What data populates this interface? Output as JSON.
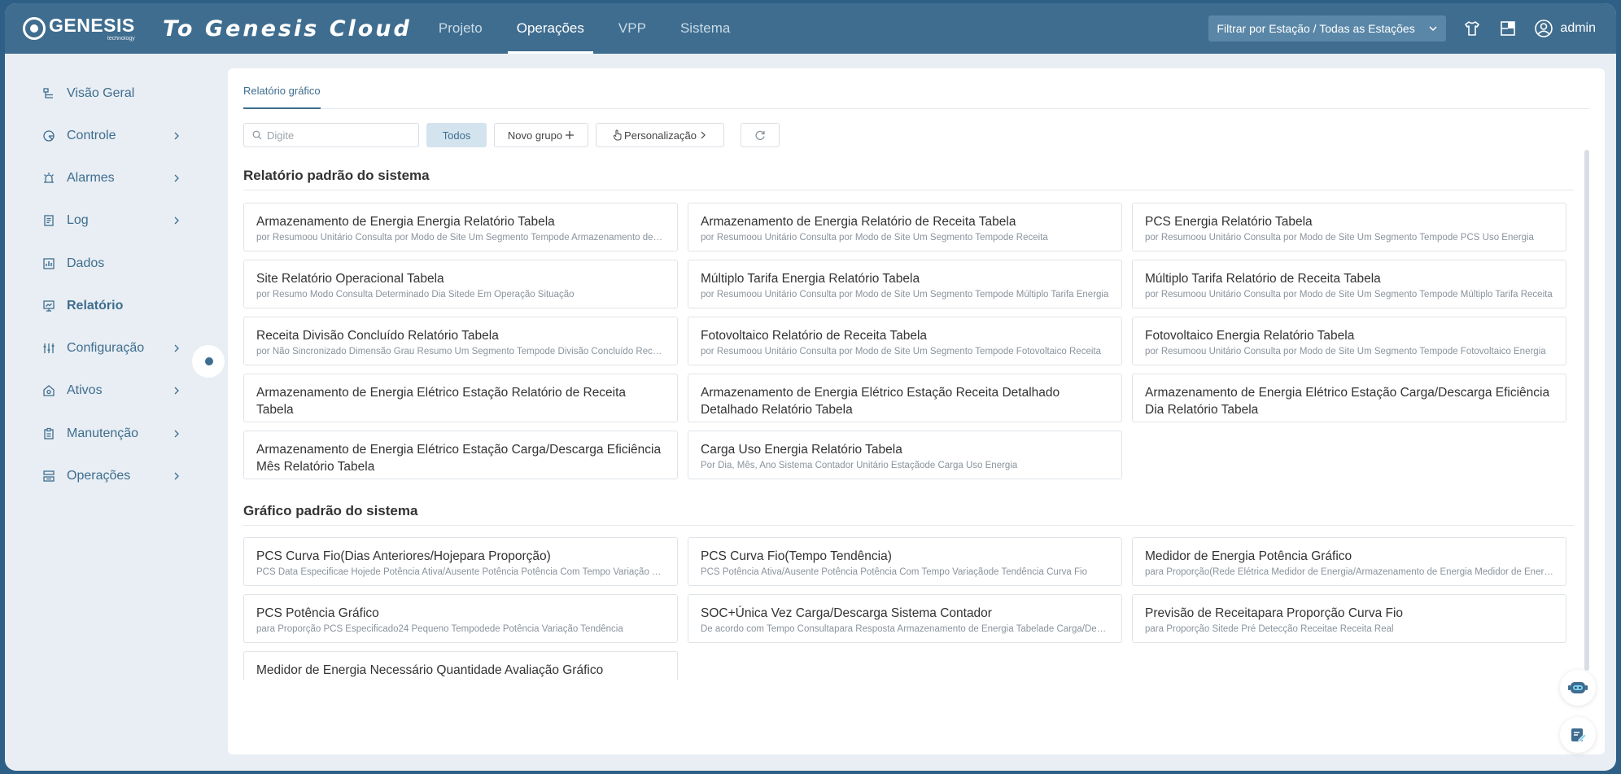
{
  "header": {
    "logo_text": "GENESIS",
    "logo_sub": "technology",
    "brand_title": "To Genesis Cloud",
    "nav": [
      {
        "label": "Projeto",
        "active": false
      },
      {
        "label": "Operações",
        "active": true
      },
      {
        "label": "VPP",
        "active": false
      },
      {
        "label": "Sistema",
        "active": false
      }
    ],
    "station_filter": "Filtrar por Estação / Todas as Estações",
    "user": "admin"
  },
  "sidebar": {
    "items": [
      {
        "label": "Visão Geral",
        "icon": "overview-icon",
        "chevron": false
      },
      {
        "label": "Controle",
        "icon": "control-icon",
        "chevron": true
      },
      {
        "label": "Alarmes",
        "icon": "alarm-icon",
        "chevron": true
      },
      {
        "label": "Log",
        "icon": "log-icon",
        "chevron": true
      },
      {
        "label": "Dados",
        "icon": "data-icon",
        "chevron": false
      },
      {
        "label": "Relatório",
        "icon": "report-icon",
        "chevron": false,
        "active": true
      },
      {
        "label": "Configuração",
        "icon": "config-icon",
        "chevron": true
      },
      {
        "label": "Ativos",
        "icon": "assets-icon",
        "chevron": true
      },
      {
        "label": "Manutenção",
        "icon": "maintenance-icon",
        "chevron": true
      },
      {
        "label": "Operações",
        "icon": "operations-icon",
        "chevron": true
      }
    ]
  },
  "main": {
    "tab": "Relatório gráfico",
    "search_placeholder": "Digite",
    "btn_all": "Todos",
    "btn_new_group": "Novo grupo",
    "btn_custom": "Personalização",
    "sections": [
      {
        "title": "Relatório padrão do sistema",
        "cards": [
          {
            "title": "Armazenamento de Energia Energia Relatório Tabela",
            "desc": "por Resumoou Unitário Consulta por Modo de Site Um Segmento Tempode Armazenamento de Energia Energia"
          },
          {
            "title": "Armazenamento de Energia Relatório de Receita Tabela",
            "desc": "por Resumoou Unitário Consulta por Modo de Site Um Segmento Tempode Receita"
          },
          {
            "title": "PCS Energia Relatório Tabela",
            "desc": "por Resumoou Unitário Consulta por Modo de Site Um Segmento Tempode PCS Uso Energia"
          },
          {
            "title": "Site Relatório Operacional Tabela",
            "desc": "por Resumo Modo Consulta Determinado Dia Sitede Em Operação Situação"
          },
          {
            "title": "Múltiplo Tarifa Energia Relatório Tabela",
            "desc": "por Resumoou Unitário Consulta por Modo de Site Um Segmento Tempode Múltiplo Tarifa Energia"
          },
          {
            "title": "Múltiplo Tarifa Relatório de Receita Tabela",
            "desc": "por Resumoou Unitário Consulta por Modo de Site Um Segmento Tempode Múltiplo Tarifa Receita"
          },
          {
            "title": "Receita Divisão Concluído Relatório Tabela",
            "desc": "por Não Sincronizado Dimensão Grau Resumo Um Segmento Tempode Divisão Concluído Receita"
          },
          {
            "title": "Fotovoltaico Relatório de Receita Tabela",
            "desc": "por Resumoou Unitário Consulta por Modo de Site Um Segmento Tempode Fotovoltaico Receita"
          },
          {
            "title": "Fotovoltaico Energia Relatório Tabela",
            "desc": "por Resumoou Unitário Consulta por Modo de Site Um Segmento Tempode Fotovoltaico Energia"
          },
          {
            "title": "Armazenamento de Energia Elétrico Estação Relatório de Receita Tabela",
            "desc": ""
          },
          {
            "title": "Armazenamento de Energia Elétrico Estação Receita Detalhado Detalhado Relatório Tabela",
            "desc": ""
          },
          {
            "title": "Armazenamento de Energia Elétrico Estação Carga/Descarga Eficiência Dia Relatório Tabela",
            "desc": ""
          },
          {
            "title": "Armazenamento de Energia Elétrico Estação Carga/Descarga Eficiência Mês Relatório Tabela",
            "desc": ""
          },
          {
            "title": "Carga Uso Energia Relatório Tabela",
            "desc": "Por Dia, Mês, Ano Sistema Contador Unitário Estaçãode Carga Uso Energia"
          }
        ]
      },
      {
        "title": "Gráfico padrão do sistema",
        "cards": [
          {
            "title": "PCS Curva Fio(Dias Anteriores/Hojepara Proporção)",
            "desc": "PCS Data Especificae Hojede Potência Ativa/Ausente Potência Potência Com Tempo Variação Tendência"
          },
          {
            "title": "PCS Curva Fio(Tempo Tendência)",
            "desc": "PCS Potência Ativa/Ausente Potência Potência Com Tempo Variaçãode Tendência Curva Fio"
          },
          {
            "title": "Medidor de Energia Potência Gráfico",
            "desc": "para Proporção(Rede Elétrica Medidor de Energia/Armazenamento de Energia Medidor de Energia) Potência"
          },
          {
            "title": "PCS Potência Gráfico",
            "desc": "para Proporção PCS Especificado24 Pequeno Tempodede Potência Variação Tendência"
          },
          {
            "title": "SOC+Única Vez Carga/Descarga Sistema Contador",
            "desc": "De acordo com Tempo Consultapara Resposta Armazenamento de Energia Tabelade Carga/Descarga"
          },
          {
            "title": "Previsão de Receitapara Proporção Curva Fio",
            "desc": "para Proporção Sitede Pré Detecção Receitae Receita Real"
          },
          {
            "title": "Medidor de Energia Necessário Quantidade Avaliação Gráfico",
            "desc": ""
          }
        ]
      }
    ]
  }
}
